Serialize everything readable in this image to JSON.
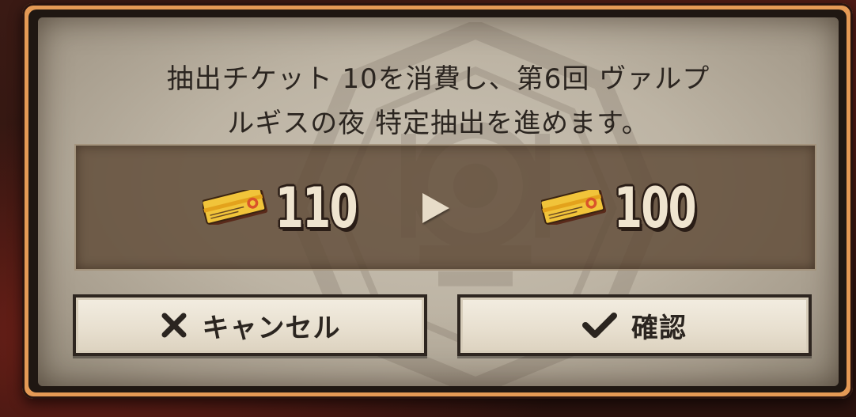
{
  "dialog": {
    "message_line1": "抽出チケット 10を消費し、第6回 ヴァルプ",
    "message_line2": "ルギスの夜 特定抽出を進めます。"
  },
  "ticket_change": {
    "icon": "gacha-ticket-icon",
    "before": "110",
    "after": "100",
    "arrow_icon": "play-arrow-icon"
  },
  "buttons": {
    "cancel_label": "キャンセル",
    "cancel_icon": "close-x-icon",
    "confirm_label": "確認",
    "confirm_icon": "checkmark-icon"
  },
  "colors": {
    "frame_accent": "#e59a55",
    "panel_bg": "#bdb4a4",
    "count_text": "#efe4cf",
    "button_bg": "#ebe3d3",
    "dark_text": "#2b2520"
  }
}
